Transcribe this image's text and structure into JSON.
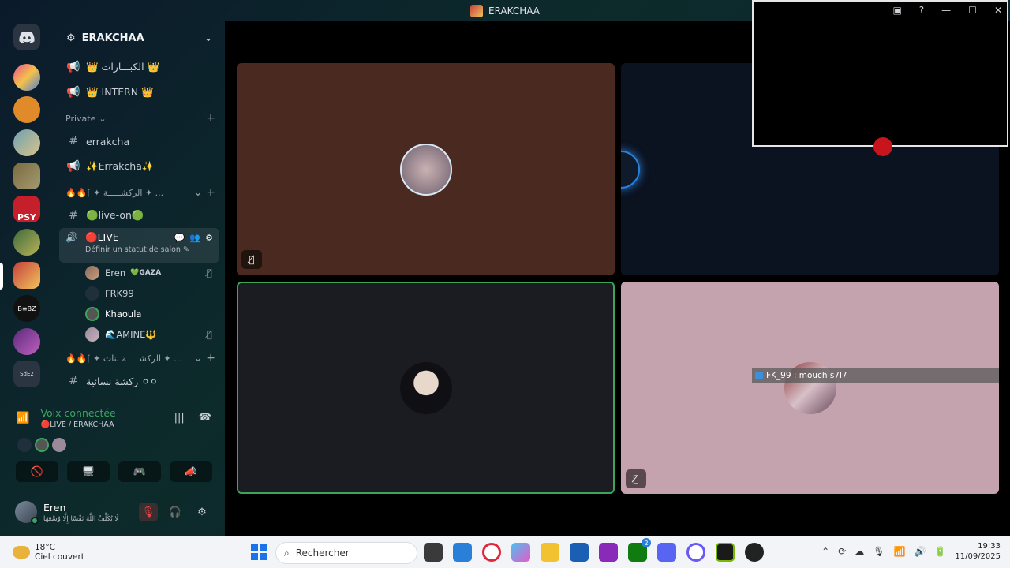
{
  "window": {
    "title": "ERAKCHAA"
  },
  "server": {
    "name": "ERAKCHAA"
  },
  "channels": [
    {
      "name": "👑 الكبـــارات 👑",
      "type": "announcement"
    },
    {
      "name": "👑 INTERN 👑",
      "type": "announcement"
    }
  ],
  "private_category": {
    "label": "Private"
  },
  "private_channels": [
    {
      "name": "errakcha",
      "type": "text"
    },
    {
      "name": "✨Errakcha✨",
      "type": "announcement"
    }
  ],
  "category2": {
    "label": "🔥🔥⌈ ✦ الركشـــــة ✦ ..."
  },
  "live_on": {
    "name": "🟢live-on🟢"
  },
  "live_channel": {
    "name": "🔴LIVE",
    "status_hint": "Définir un statut de salon"
  },
  "voice_users": [
    {
      "name": "Eren",
      "tag": "💚GAZA",
      "muted": true
    },
    {
      "name": "FRK99",
      "tag": "",
      "muted": false
    },
    {
      "name": "Khaoula",
      "tag": "",
      "muted": false
    },
    {
      "name": "🌊AMINE🔱",
      "tag": "",
      "muted": true
    }
  ],
  "category3": {
    "label": "🔥🔥⌈ ✦ الركشـــــة بنات ✦ ..."
  },
  "last_channel": {
    "name": "ركشة نسائية ⚪⚪"
  },
  "voice_panel": {
    "title": "Voix connectée",
    "subtitle": "🔴LIVE / ERAKCHAA"
  },
  "user": {
    "name": "Eren",
    "status": "لَا يُكَلِّفُ اللَّهُ نَفْسًا إِلَّا وُسْعَهَا"
  },
  "overlay": {
    "label": "FK_99 : mouch s7l7"
  },
  "taskbar": {
    "weather_temp": "18°C",
    "weather_desc": "Ciel couvert",
    "search_placeholder": "Rechercher",
    "time": "19:33",
    "date": "11/09/2025",
    "xbox_badge": "2"
  },
  "colors": {
    "accent_green": "#3ba55c",
    "live_red": "#e03535",
    "tile_brown": "#4a2a20",
    "tile_navy": "#0b1220",
    "tile_dark": "#1b1b22",
    "tile_pink": "#c5a3ae"
  }
}
